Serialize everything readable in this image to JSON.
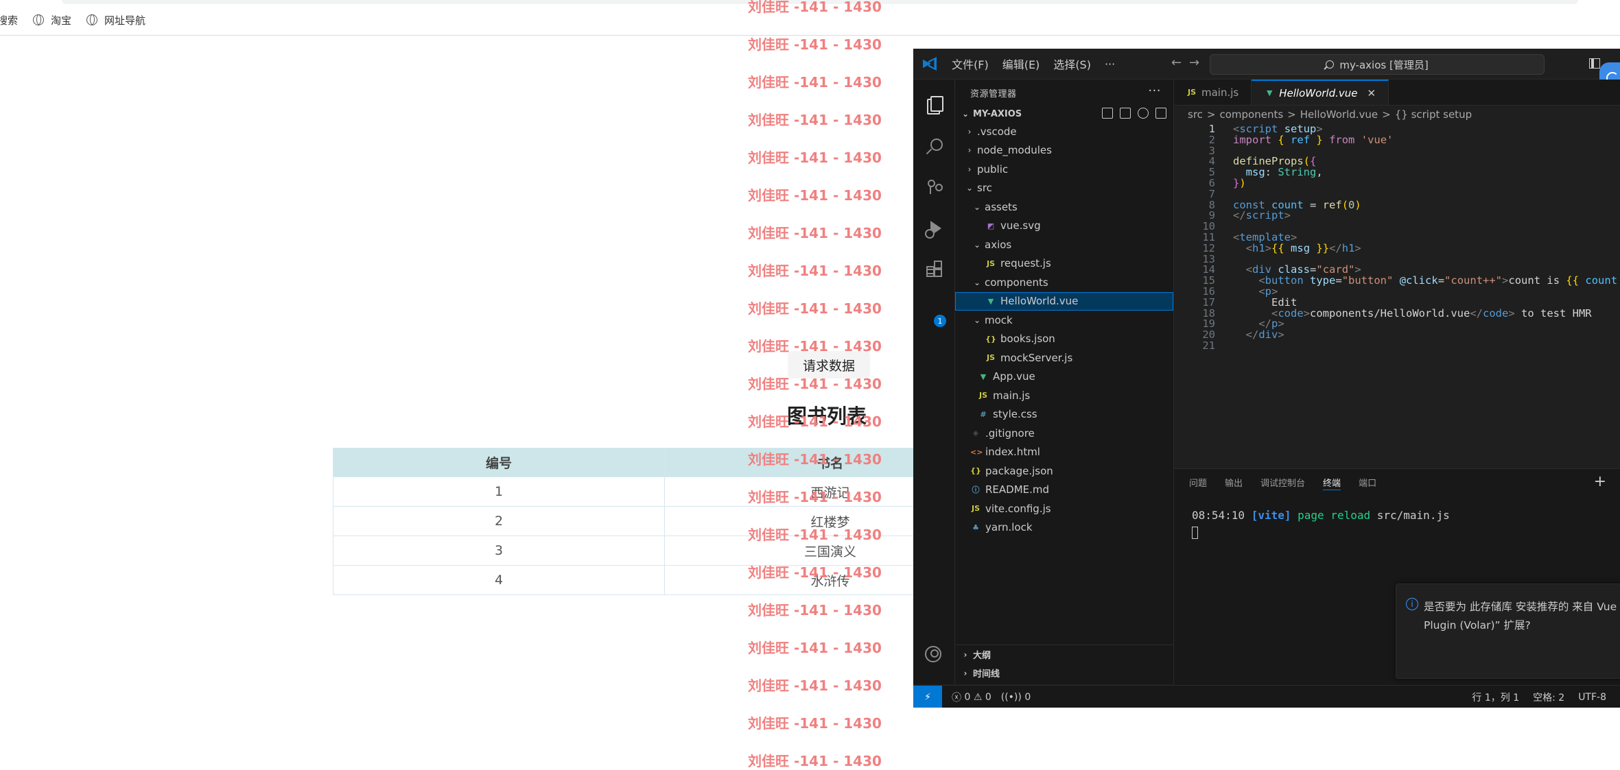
{
  "browser": {
    "bookmarks": [
      "搜索",
      "淘宝",
      "网址导航"
    ],
    "watermark": "刘佳旺 -141 - 1430",
    "request_button": "请求数据",
    "page_title": "图书列表",
    "table": {
      "headers": [
        "编号",
        "书名"
      ],
      "rows": [
        [
          "1",
          "西游记"
        ],
        [
          "2",
          "红楼梦"
        ],
        [
          "3",
          "三国演义"
        ],
        [
          "4",
          "水浒传"
        ]
      ]
    }
  },
  "vscode": {
    "menu": [
      "文件(F)",
      "编辑(E)",
      "选择(S)",
      "···"
    ],
    "command_center": "my-axios [管理员]",
    "explorer_title": "资源管理器",
    "explorer_more": "···",
    "project_name": "MY-AXIOS",
    "tree": [
      {
        "label": ".vscode",
        "chev": "›",
        "icon": "",
        "level": 0
      },
      {
        "label": "node_modules",
        "chev": "›",
        "icon": "",
        "level": 0
      },
      {
        "label": "public",
        "chev": "›",
        "icon": "",
        "level": 0
      },
      {
        "label": "src",
        "chev": "⌄",
        "icon": "",
        "level": 0
      },
      {
        "label": "assets",
        "chev": "⌄",
        "icon": "",
        "level": 1
      },
      {
        "label": "vue.svg",
        "chev": "",
        "icon": "svg",
        "level": 2
      },
      {
        "label": "axios",
        "chev": "⌄",
        "icon": "",
        "level": 1
      },
      {
        "label": "request.js",
        "chev": "",
        "icon": "js",
        "level": 2
      },
      {
        "label": "components",
        "chev": "⌄",
        "icon": "",
        "level": 1
      },
      {
        "label": "HelloWorld.vue",
        "chev": "",
        "icon": "vue",
        "level": 2,
        "selected": true
      },
      {
        "label": "mock",
        "chev": "⌄",
        "icon": "",
        "level": 1
      },
      {
        "label": "books.json",
        "chev": "",
        "icon": "json",
        "level": 2
      },
      {
        "label": "mockServer.js",
        "chev": "",
        "icon": "js",
        "level": 2
      },
      {
        "label": "App.vue",
        "chev": "",
        "icon": "vue",
        "level": 1
      },
      {
        "label": "main.js",
        "chev": "",
        "icon": "js",
        "level": 1
      },
      {
        "label": "style.css",
        "chev": "",
        "icon": "css",
        "level": 1
      },
      {
        "label": ".gitignore",
        "chev": "",
        "icon": "git",
        "level": 0
      },
      {
        "label": "index.html",
        "chev": "",
        "icon": "html",
        "level": 0
      },
      {
        "label": "package.json",
        "chev": "",
        "icon": "json",
        "level": 0
      },
      {
        "label": "README.md",
        "chev": "",
        "icon": "info",
        "level": 0
      },
      {
        "label": "vite.config.js",
        "chev": "",
        "icon": "js",
        "level": 0
      },
      {
        "label": "yarn.lock",
        "chev": "",
        "icon": "yarn",
        "level": 0
      }
    ],
    "icon_glyphs": {
      "js": "JS",
      "json": "{}",
      "vue": "▼",
      "css": "#",
      "html": "<>",
      "git": "◈",
      "info": "ⓘ",
      "yarn": "♣",
      "svg": "◩"
    },
    "outline_label": "大纲",
    "timeline_label": "时间线",
    "tabs": [
      {
        "label": "main.js",
        "icon": "JS",
        "active": false
      },
      {
        "label": "HelloWorld.vue",
        "icon": "▼",
        "active": true
      }
    ],
    "breadcrumb": [
      "src",
      ">",
      "components",
      ">",
      "HelloWorld.vue",
      ">",
      "{} script setup"
    ],
    "code_lines": [
      [
        [
          "t-tag",
          "<"
        ],
        [
          "t-el",
          "script"
        ],
        [
          "t-plain",
          " "
        ],
        [
          "t-attr",
          "setup"
        ],
        [
          "t-tag",
          ">"
        ]
      ],
      [
        [
          "t-kw",
          "import"
        ],
        [
          "t-plain",
          " "
        ],
        [
          "t-br",
          "{"
        ],
        [
          "t-plain",
          " "
        ],
        [
          "t-var",
          "ref"
        ],
        [
          "t-plain",
          " "
        ],
        [
          "t-br",
          "}"
        ],
        [
          "t-plain",
          " "
        ],
        [
          "t-kw",
          "from"
        ],
        [
          "t-plain",
          " "
        ],
        [
          "t-str",
          "'vue'"
        ]
      ],
      [],
      [
        [
          "t-fn",
          "defineProps"
        ],
        [
          "t-br",
          "("
        ],
        [
          "t-br2",
          "{"
        ]
      ],
      [
        [
          "t-plain",
          "  "
        ],
        [
          "t-attr",
          "msg"
        ],
        [
          "t-plain",
          ": "
        ],
        [
          "t-ty",
          "String"
        ],
        [
          "t-plain",
          ","
        ]
      ],
      [
        [
          "t-br2",
          "}"
        ],
        [
          "t-br",
          ")"
        ]
      ],
      [],
      [
        [
          "t-const",
          "const"
        ],
        [
          "t-plain",
          " "
        ],
        [
          "t-var",
          "count"
        ],
        [
          "t-plain",
          " = "
        ],
        [
          "t-fn",
          "ref"
        ],
        [
          "t-br",
          "("
        ],
        [
          "t-num",
          "0"
        ],
        [
          "t-br",
          ")"
        ]
      ],
      [
        [
          "t-tag",
          "</"
        ],
        [
          "t-el",
          "script"
        ],
        [
          "t-tag",
          ">"
        ]
      ],
      [],
      [
        [
          "t-tag",
          "<"
        ],
        [
          "t-el",
          "template"
        ],
        [
          "t-tag",
          ">"
        ]
      ],
      [
        [
          "t-plain",
          "  "
        ],
        [
          "t-tag",
          "<"
        ],
        [
          "t-el",
          "h1"
        ],
        [
          "t-tag",
          ">"
        ],
        [
          "t-br",
          "{{"
        ],
        [
          "t-plain",
          " "
        ],
        [
          "t-attr",
          "msg"
        ],
        [
          "t-plain",
          " "
        ],
        [
          "t-br",
          "}}"
        ],
        [
          "t-tag",
          "</"
        ],
        [
          "t-el",
          "h1"
        ],
        [
          "t-tag",
          ">"
        ]
      ],
      [],
      [
        [
          "t-plain",
          "  "
        ],
        [
          "t-tag",
          "<"
        ],
        [
          "t-el",
          "div"
        ],
        [
          "t-plain",
          " "
        ],
        [
          "t-attr",
          "class"
        ],
        [
          "t-plain",
          "="
        ],
        [
          "t-str",
          "\"card\""
        ],
        [
          "t-tag",
          ">"
        ]
      ],
      [
        [
          "t-plain",
          "    "
        ],
        [
          "t-tag",
          "<"
        ],
        [
          "t-el",
          "button"
        ],
        [
          "t-plain",
          " "
        ],
        [
          "t-attr",
          "type"
        ],
        [
          "t-plain",
          "="
        ],
        [
          "t-str",
          "\"button\""
        ],
        [
          "t-plain",
          " "
        ],
        [
          "t-attr",
          "@click"
        ],
        [
          "t-plain",
          "="
        ],
        [
          "t-str",
          "\"count++\""
        ],
        [
          "t-tag",
          ">"
        ],
        [
          "t-plain",
          "count is "
        ],
        [
          "t-br",
          "{{"
        ],
        [
          "t-plain",
          " "
        ],
        [
          "t-var",
          "count"
        ],
        [
          "t-plain",
          " "
        ],
        [
          "t-br",
          "}}"
        ]
      ],
      [
        [
          "t-plain",
          "    "
        ],
        [
          "t-tag",
          "<"
        ],
        [
          "t-el",
          "p"
        ],
        [
          "t-tag",
          ">"
        ]
      ],
      [
        [
          "t-plain",
          "      Edit"
        ]
      ],
      [
        [
          "t-plain",
          "      "
        ],
        [
          "t-tag",
          "<"
        ],
        [
          "t-el",
          "code"
        ],
        [
          "t-tag",
          ">"
        ],
        [
          "t-plain",
          "components/HelloWorld.vue"
        ],
        [
          "t-tag",
          "</"
        ],
        [
          "t-el",
          "code"
        ],
        [
          "t-tag",
          ">"
        ],
        [
          "t-plain",
          " to test HMR"
        ]
      ],
      [
        [
          "t-plain",
          "    "
        ],
        [
          "t-tag",
          "</"
        ],
        [
          "t-el",
          "p"
        ],
        [
          "t-tag",
          ">"
        ]
      ],
      [
        [
          "t-plain",
          "  "
        ],
        [
          "t-tag",
          "</"
        ],
        [
          "t-el",
          "div"
        ],
        [
          "t-tag",
          ">"
        ]
      ],
      []
    ],
    "panel_tabs": [
      "问题",
      "输出",
      "调试控制台",
      "终端",
      "端口"
    ],
    "terminal": {
      "time": "08:54:10",
      "tag": "[vite]",
      "message": "page reload",
      "path": "src/main.js"
    },
    "toast": "是否要为 此存储库 安装推荐的 来自 Vue Plugin (Volar)” 扩展?",
    "status": {
      "remote": "⚡",
      "errors": "0",
      "warnings": "0",
      "ports": "0",
      "position": "行 1，列 1",
      "spaces": "空格: 2",
      "encoding": "UTF-8"
    }
  }
}
